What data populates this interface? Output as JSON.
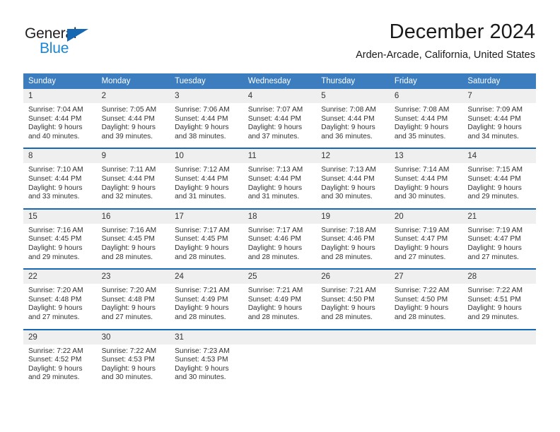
{
  "brand": {
    "name_part1": "General",
    "name_part2": "Blue",
    "triangle_icon": "triangle-icon",
    "color_dark": "#231f20",
    "color_blue": "#1b87d4"
  },
  "header": {
    "title": "December 2024",
    "subtitle": "Arden-Arcade, California, United States"
  },
  "colors": {
    "header_bg": "#3b7dbf",
    "week_separator": "#1668b3",
    "daynum_bg": "#efefef",
    "text": "#333333"
  },
  "weekday_headers": [
    "Sunday",
    "Monday",
    "Tuesday",
    "Wednesday",
    "Thursday",
    "Friday",
    "Saturday"
  ],
  "weeks": [
    {
      "days": [
        {
          "date": "1",
          "sunrise": "Sunrise: 7:04 AM",
          "sunset": "Sunset: 4:44 PM",
          "daylight_line1": "Daylight: 9 hours",
          "daylight_line2": "and 40 minutes."
        },
        {
          "date": "2",
          "sunrise": "Sunrise: 7:05 AM",
          "sunset": "Sunset: 4:44 PM",
          "daylight_line1": "Daylight: 9 hours",
          "daylight_line2": "and 39 minutes."
        },
        {
          "date": "3",
          "sunrise": "Sunrise: 7:06 AM",
          "sunset": "Sunset: 4:44 PM",
          "daylight_line1": "Daylight: 9 hours",
          "daylight_line2": "and 38 minutes."
        },
        {
          "date": "4",
          "sunrise": "Sunrise: 7:07 AM",
          "sunset": "Sunset: 4:44 PM",
          "daylight_line1": "Daylight: 9 hours",
          "daylight_line2": "and 37 minutes."
        },
        {
          "date": "5",
          "sunrise": "Sunrise: 7:08 AM",
          "sunset": "Sunset: 4:44 PM",
          "daylight_line1": "Daylight: 9 hours",
          "daylight_line2": "and 36 minutes."
        },
        {
          "date": "6",
          "sunrise": "Sunrise: 7:08 AM",
          "sunset": "Sunset: 4:44 PM",
          "daylight_line1": "Daylight: 9 hours",
          "daylight_line2": "and 35 minutes."
        },
        {
          "date": "7",
          "sunrise": "Sunrise: 7:09 AM",
          "sunset": "Sunset: 4:44 PM",
          "daylight_line1": "Daylight: 9 hours",
          "daylight_line2": "and 34 minutes."
        }
      ]
    },
    {
      "days": [
        {
          "date": "8",
          "sunrise": "Sunrise: 7:10 AM",
          "sunset": "Sunset: 4:44 PM",
          "daylight_line1": "Daylight: 9 hours",
          "daylight_line2": "and 33 minutes."
        },
        {
          "date": "9",
          "sunrise": "Sunrise: 7:11 AM",
          "sunset": "Sunset: 4:44 PM",
          "daylight_line1": "Daylight: 9 hours",
          "daylight_line2": "and 32 minutes."
        },
        {
          "date": "10",
          "sunrise": "Sunrise: 7:12 AM",
          "sunset": "Sunset: 4:44 PM",
          "daylight_line1": "Daylight: 9 hours",
          "daylight_line2": "and 31 minutes."
        },
        {
          "date": "11",
          "sunrise": "Sunrise: 7:13 AM",
          "sunset": "Sunset: 4:44 PM",
          "daylight_line1": "Daylight: 9 hours",
          "daylight_line2": "and 31 minutes."
        },
        {
          "date": "12",
          "sunrise": "Sunrise: 7:13 AM",
          "sunset": "Sunset: 4:44 PM",
          "daylight_line1": "Daylight: 9 hours",
          "daylight_line2": "and 30 minutes."
        },
        {
          "date": "13",
          "sunrise": "Sunrise: 7:14 AM",
          "sunset": "Sunset: 4:44 PM",
          "daylight_line1": "Daylight: 9 hours",
          "daylight_line2": "and 30 minutes."
        },
        {
          "date": "14",
          "sunrise": "Sunrise: 7:15 AM",
          "sunset": "Sunset: 4:44 PM",
          "daylight_line1": "Daylight: 9 hours",
          "daylight_line2": "and 29 minutes."
        }
      ]
    },
    {
      "days": [
        {
          "date": "15",
          "sunrise": "Sunrise: 7:16 AM",
          "sunset": "Sunset: 4:45 PM",
          "daylight_line1": "Daylight: 9 hours",
          "daylight_line2": "and 29 minutes."
        },
        {
          "date": "16",
          "sunrise": "Sunrise: 7:16 AM",
          "sunset": "Sunset: 4:45 PM",
          "daylight_line1": "Daylight: 9 hours",
          "daylight_line2": "and 28 minutes."
        },
        {
          "date": "17",
          "sunrise": "Sunrise: 7:17 AM",
          "sunset": "Sunset: 4:45 PM",
          "daylight_line1": "Daylight: 9 hours",
          "daylight_line2": "and 28 minutes."
        },
        {
          "date": "18",
          "sunrise": "Sunrise: 7:17 AM",
          "sunset": "Sunset: 4:46 PM",
          "daylight_line1": "Daylight: 9 hours",
          "daylight_line2": "and 28 minutes."
        },
        {
          "date": "19",
          "sunrise": "Sunrise: 7:18 AM",
          "sunset": "Sunset: 4:46 PM",
          "daylight_line1": "Daylight: 9 hours",
          "daylight_line2": "and 28 minutes."
        },
        {
          "date": "20",
          "sunrise": "Sunrise: 7:19 AM",
          "sunset": "Sunset: 4:47 PM",
          "daylight_line1": "Daylight: 9 hours",
          "daylight_line2": "and 27 minutes."
        },
        {
          "date": "21",
          "sunrise": "Sunrise: 7:19 AM",
          "sunset": "Sunset: 4:47 PM",
          "daylight_line1": "Daylight: 9 hours",
          "daylight_line2": "and 27 minutes."
        }
      ]
    },
    {
      "days": [
        {
          "date": "22",
          "sunrise": "Sunrise: 7:20 AM",
          "sunset": "Sunset: 4:48 PM",
          "daylight_line1": "Daylight: 9 hours",
          "daylight_line2": "and 27 minutes."
        },
        {
          "date": "23",
          "sunrise": "Sunrise: 7:20 AM",
          "sunset": "Sunset: 4:48 PM",
          "daylight_line1": "Daylight: 9 hours",
          "daylight_line2": "and 27 minutes."
        },
        {
          "date": "24",
          "sunrise": "Sunrise: 7:21 AM",
          "sunset": "Sunset: 4:49 PM",
          "daylight_line1": "Daylight: 9 hours",
          "daylight_line2": "and 28 minutes."
        },
        {
          "date": "25",
          "sunrise": "Sunrise: 7:21 AM",
          "sunset": "Sunset: 4:49 PM",
          "daylight_line1": "Daylight: 9 hours",
          "daylight_line2": "and 28 minutes."
        },
        {
          "date": "26",
          "sunrise": "Sunrise: 7:21 AM",
          "sunset": "Sunset: 4:50 PM",
          "daylight_line1": "Daylight: 9 hours",
          "daylight_line2": "and 28 minutes."
        },
        {
          "date": "27",
          "sunrise": "Sunrise: 7:22 AM",
          "sunset": "Sunset: 4:50 PM",
          "daylight_line1": "Daylight: 9 hours",
          "daylight_line2": "and 28 minutes."
        },
        {
          "date": "28",
          "sunrise": "Sunrise: 7:22 AM",
          "sunset": "Sunset: 4:51 PM",
          "daylight_line1": "Daylight: 9 hours",
          "daylight_line2": "and 29 minutes."
        }
      ]
    },
    {
      "days": [
        {
          "date": "29",
          "sunrise": "Sunrise: 7:22 AM",
          "sunset": "Sunset: 4:52 PM",
          "daylight_line1": "Daylight: 9 hours",
          "daylight_line2": "and 29 minutes."
        },
        {
          "date": "30",
          "sunrise": "Sunrise: 7:22 AM",
          "sunset": "Sunset: 4:53 PM",
          "daylight_line1": "Daylight: 9 hours",
          "daylight_line2": "and 30 minutes."
        },
        {
          "date": "31",
          "sunrise": "Sunrise: 7:23 AM",
          "sunset": "Sunset: 4:53 PM",
          "daylight_line1": "Daylight: 9 hours",
          "daylight_line2": "and 30 minutes."
        },
        {
          "date": "",
          "sunrise": "",
          "sunset": "",
          "daylight_line1": "",
          "daylight_line2": ""
        },
        {
          "date": "",
          "sunrise": "",
          "sunset": "",
          "daylight_line1": "",
          "daylight_line2": ""
        },
        {
          "date": "",
          "sunrise": "",
          "sunset": "",
          "daylight_line1": "",
          "daylight_line2": ""
        },
        {
          "date": "",
          "sunrise": "",
          "sunset": "",
          "daylight_line1": "",
          "daylight_line2": ""
        }
      ]
    }
  ]
}
